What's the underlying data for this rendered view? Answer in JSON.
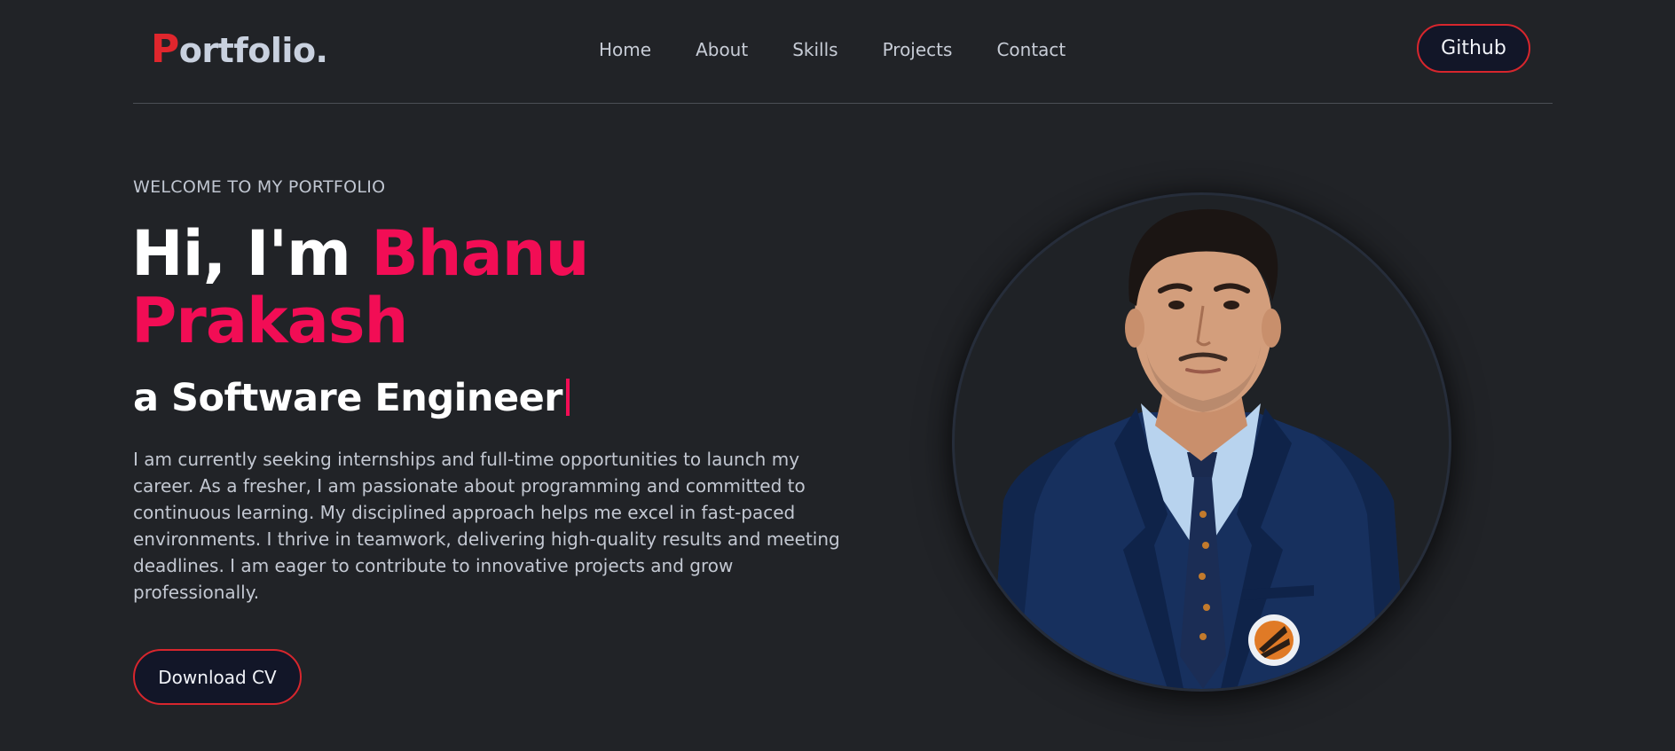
{
  "header": {
    "logo_first": "P",
    "logo_rest": "ortfolio.",
    "nav": [
      {
        "label": "Home"
      },
      {
        "label": "About"
      },
      {
        "label": "Skills"
      },
      {
        "label": "Projects"
      },
      {
        "label": "Contact"
      }
    ],
    "github_label": "Github"
  },
  "hero": {
    "welcome": "WELCOME TO MY PORTFOLIO",
    "greeting": "Hi, I'm ",
    "name": "Bhanu Prakash",
    "role": "a Software Engineer",
    "bio": "I am currently seeking internships and full-time opportunities to launch my career. As a fresher, I am passionate about programming and committed to continuous learning. My disciplined approach helps me excel in fast-paced environments. I thrive in teamwork, delivering high-quality results and meeting deadlines. I am eager to contribute to innovative projects and grow professionally.",
    "cv_label": "Download CV"
  },
  "colors": {
    "background": "#212327",
    "accent": "#f20d55",
    "logo_accent": "#e0262d",
    "button_border": "#d7262d",
    "button_fill": "#121628"
  }
}
